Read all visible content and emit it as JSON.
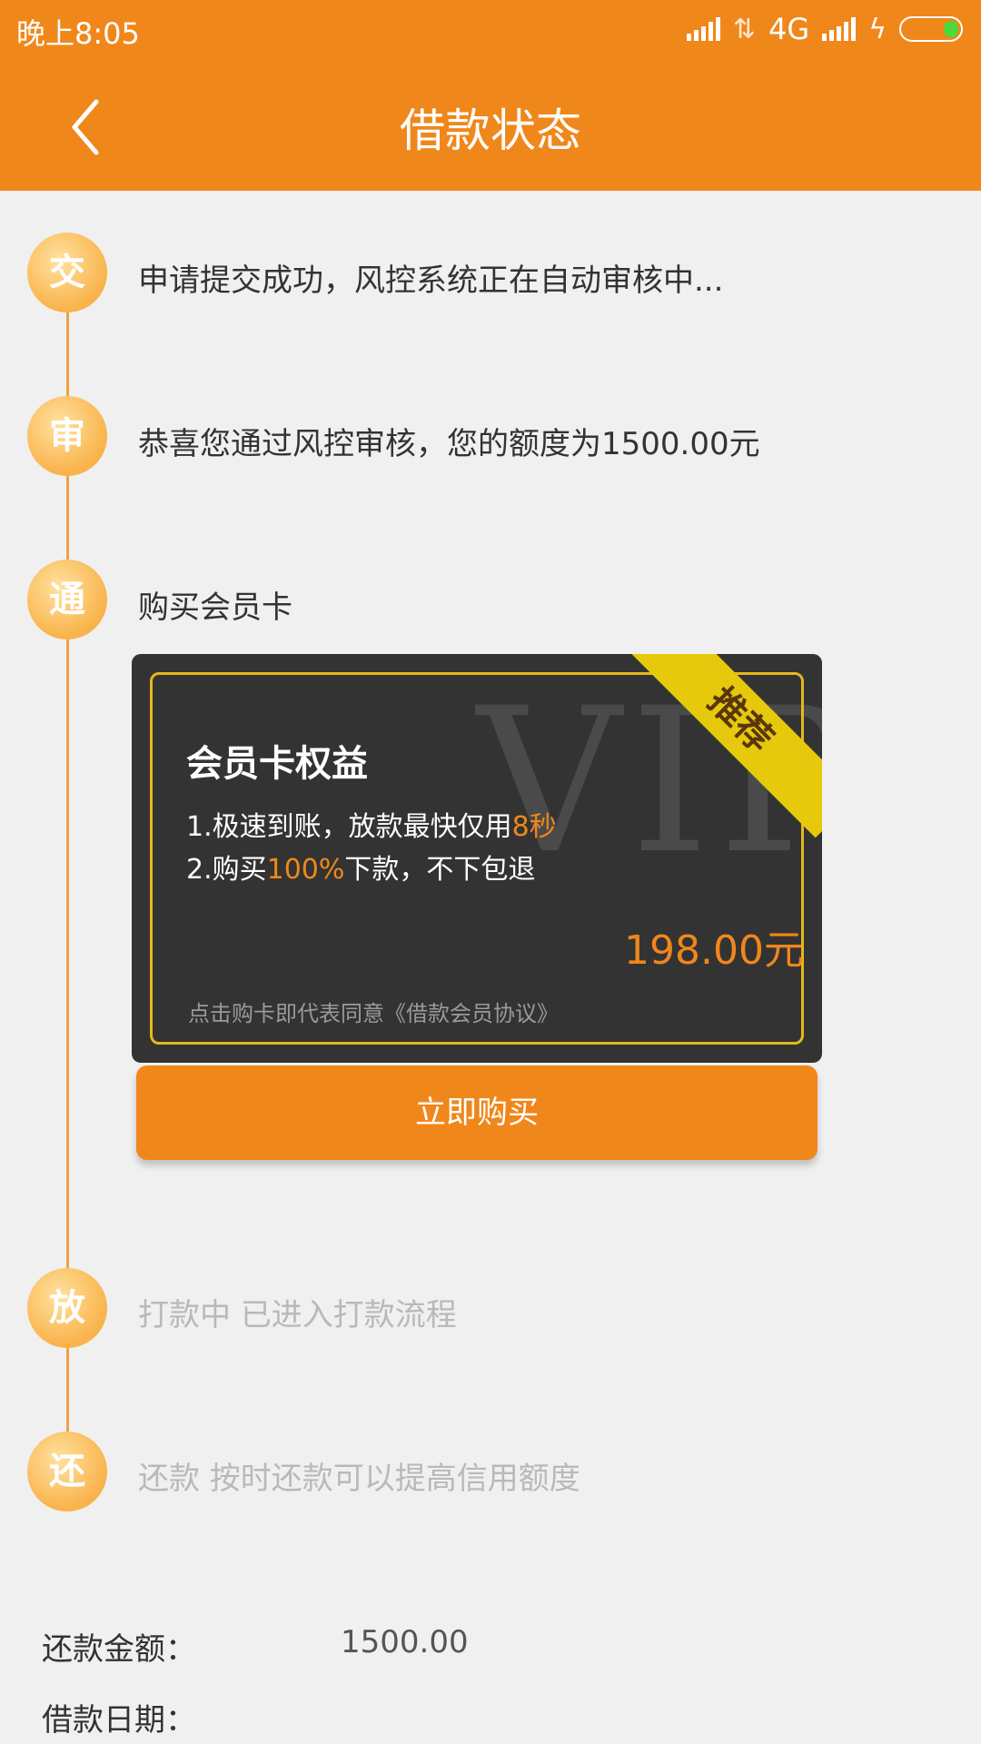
{
  "status_bar": {
    "time": "晚上8:05",
    "network": "4G",
    "battery_color": "#4cd93a"
  },
  "header": {
    "title": "借款状态",
    "back_icon": "chevron-left-icon",
    "background": "#f0871b"
  },
  "timeline": {
    "steps": [
      {
        "badge": "交",
        "text": "申请提交成功，风控系统正在自动审核中...",
        "state": "done"
      },
      {
        "badge": "审",
        "text": "恭喜您通过风控审核，您的额度为1500.00元",
        "state": "done"
      },
      {
        "badge": "通",
        "text": "购买会员卡",
        "state": "current"
      },
      {
        "badge": "放",
        "text": "打款中 已进入打款流程",
        "state": "pending"
      },
      {
        "badge": "还",
        "text": "还款 按时还款可以提高信用额度",
        "state": "pending"
      }
    ]
  },
  "member_card": {
    "ribbon": "推荐",
    "watermark": "VIP",
    "title": "会员卡权益",
    "benefit_1_prefix": "1.极速到账，放款最快仅用",
    "benefit_1_highlight": "8秒",
    "benefit_2_prefix": "2.购买",
    "benefit_2_highlight": "100%",
    "benefit_2_suffix": "下款，不下包退",
    "price": "198.00元",
    "agreement": "点击购卡即代表同意《借款会员协议》"
  },
  "buy_button": {
    "label": "立即购买"
  },
  "repayment": {
    "amount_label": "还款金额：",
    "amount_value": "1500.00",
    "date_label": "借款日期："
  }
}
